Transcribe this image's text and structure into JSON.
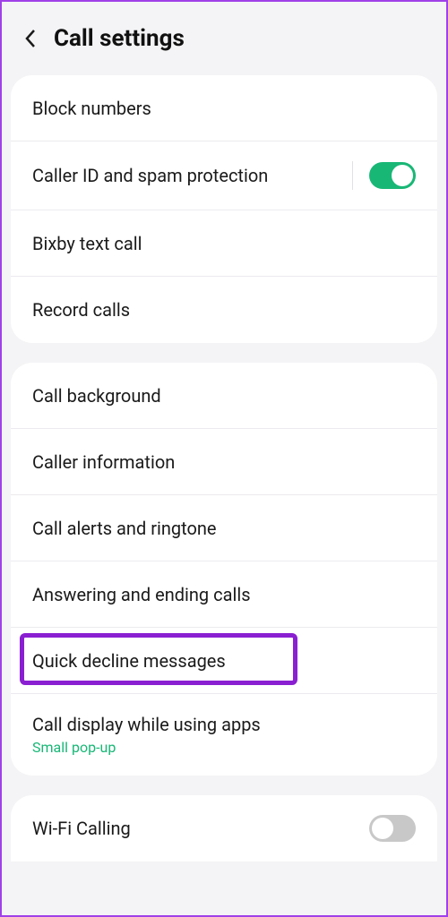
{
  "header": {
    "title": "Call settings"
  },
  "group1": {
    "items": [
      {
        "label": "Block numbers"
      },
      {
        "label": "Caller ID and spam protection",
        "toggle": "on"
      },
      {
        "label": "Bixby text call"
      },
      {
        "label": "Record calls"
      }
    ]
  },
  "group2": {
    "items": [
      {
        "label": "Call background"
      },
      {
        "label": "Caller information"
      },
      {
        "label": "Call alerts and ringtone"
      },
      {
        "label": "Answering and ending calls"
      },
      {
        "label": "Quick decline messages"
      },
      {
        "label": "Call display while using apps",
        "sub": "Small pop-up"
      }
    ]
  },
  "group3": {
    "items": [
      {
        "label": "Wi-Fi Calling",
        "toggle": "off"
      }
    ]
  }
}
